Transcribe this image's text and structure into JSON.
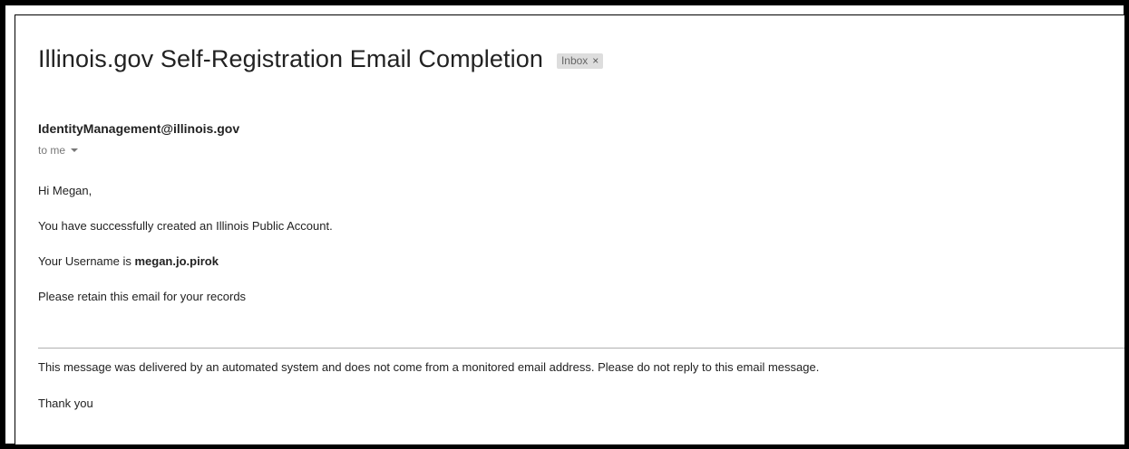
{
  "email": {
    "subject": "Illinois.gov Self-Registration Email Completion",
    "label_badge": {
      "text": "Inbox",
      "remove_glyph": "×"
    },
    "sender": "IdentityManagement@illinois.gov",
    "recipient_line": "to me",
    "recipient_details_icon": "chevron-down-icon",
    "body": {
      "greeting": "Hi Megan,",
      "line1": "You have successfully created an Illinois Public Account.",
      "username_prefix": "Your Username is ",
      "username": "megan.jo.pirok",
      "line3": "Please retain this email for your records",
      "footer_notice": "This message was delivered by an automated system and does not come from a monitored email address. Please do not reply to this email message.",
      "closing": "Thank you"
    }
  },
  "colors": {
    "frame": "#000000",
    "text": "#222222",
    "muted_text": "#777777",
    "badge_bg": "#dddddd",
    "divider": "#b0b0b0"
  }
}
